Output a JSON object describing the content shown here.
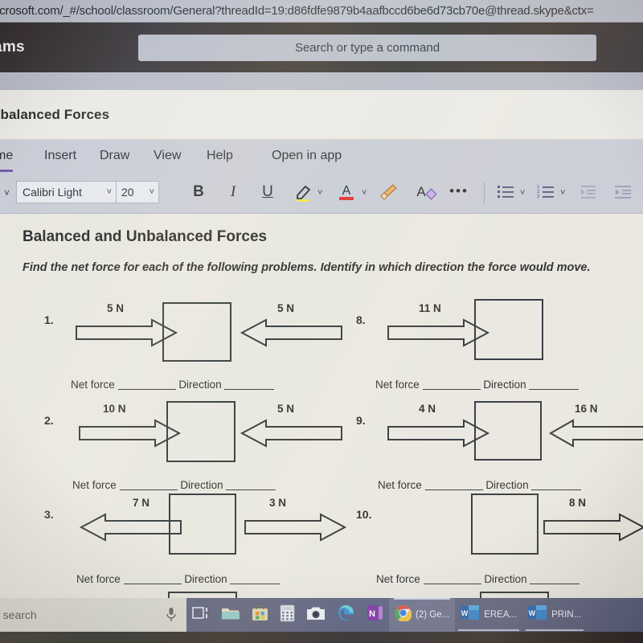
{
  "browser": {
    "url": "icrosoft.com/_#/school/classroom/General?threadId=19:d86fdfe9879b4aafbccd6be6d73cb70e@thread.skype&ctx="
  },
  "teams": {
    "app_name": "ams",
    "search_placeholder": "Search or type a command"
  },
  "document": {
    "titlebar": "nbalanced Forces",
    "heading": "Balanced and Unbalanced Forces",
    "instructions": "Find the net force for each of the following problems.  Identify in which direction the force would move.",
    "answer_labels": {
      "net_force": "Net force",
      "direction": "Direction"
    }
  },
  "ribbon": {
    "tabs": [
      {
        "label": "me",
        "active": true
      },
      {
        "label": "Insert",
        "active": false
      },
      {
        "label": "Draw",
        "active": false
      },
      {
        "label": "View",
        "active": false
      },
      {
        "label": "Help",
        "active": false
      },
      {
        "label": "Open in app",
        "active": false
      }
    ],
    "font_name": "Calibri Light",
    "font_size": "20",
    "bold": "B",
    "italic": "I",
    "underline": "U",
    "more": "•••",
    "icons": [
      "undo-chevron-icon",
      "font-name-dropdown-icon",
      "font-size-dropdown-icon",
      "bold-icon",
      "italic-icon",
      "underline-icon",
      "highlight-color-icon",
      "font-color-icon",
      "format-painter-icon",
      "clear-formatting-icon",
      "more-options-icon",
      "bulleted-list-icon",
      "numbered-list-icon",
      "decrease-indent-icon",
      "increase-indent-icon"
    ]
  },
  "problems": [
    {
      "number": "1.",
      "left_force": "5 N",
      "left_dir": "right",
      "right_force": "5 N",
      "right_dir": "left"
    },
    {
      "number": "8.",
      "left_force": "11 N",
      "left_dir": "right",
      "right_force": "",
      "right_dir": "none"
    },
    {
      "number": "2.",
      "left_force": "10 N",
      "left_dir": "right",
      "right_force": "5 N",
      "right_dir": "left"
    },
    {
      "number": "9.",
      "left_force": "4 N",
      "left_dir": "right",
      "right_force": "16 N",
      "right_dir": "left"
    },
    {
      "number": "3.",
      "left_force": "7 N",
      "left_dir": "left",
      "right_force": "3 N",
      "right_dir": "right"
    },
    {
      "number": "10.",
      "left_force": "",
      "left_dir": "none",
      "right_force": "8 N",
      "right_dir": "right"
    }
  ],
  "taskbar": {
    "search_text": "o search",
    "items": [
      {
        "name": "microphone-icon",
        "label": ""
      },
      {
        "name": "task-view-icon",
        "label": ""
      },
      {
        "name": "file-explorer-icon",
        "label": ""
      },
      {
        "name": "microsoft-store-icon",
        "label": ""
      },
      {
        "name": "calculator-icon",
        "label": ""
      },
      {
        "name": "camera-icon",
        "label": ""
      },
      {
        "name": "microsoft-edge-icon",
        "label": ""
      },
      {
        "name": "onenote-icon",
        "label": ""
      },
      {
        "name": "google-chrome-icon",
        "label": "(2) Ge..."
      },
      {
        "name": "word-icon",
        "label": "EREA..."
      },
      {
        "name": "word-icon",
        "label": "PRIN..."
      }
    ]
  },
  "colors": {
    "teams_header": "#332b2c",
    "ribbon": "#c6c8d2",
    "page": "#e7e5dc",
    "accent_purple": "#6b4ea8",
    "taskbar": "#575b79"
  }
}
